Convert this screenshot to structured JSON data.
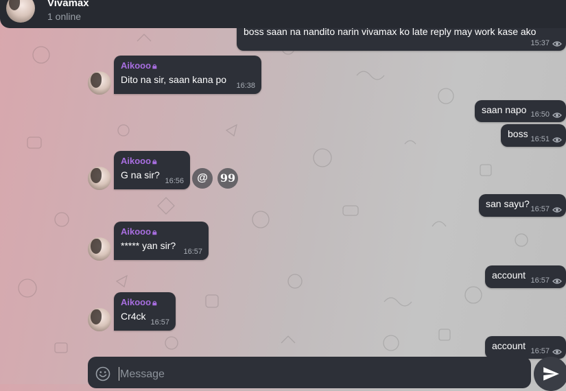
{
  "header": {
    "title": "Vivamax",
    "subtitle": "1 online"
  },
  "messages": [
    {
      "dir": "out",
      "text": "boss saan na nandito narin vivamax ko late reply may work kase ako",
      "time": "15:37"
    },
    {
      "dir": "in",
      "sender": "Aikooo",
      "text": "Dito na sir, saan kana po",
      "time": "16:38"
    },
    {
      "dir": "out",
      "text": "saan napo",
      "time": "16:50"
    },
    {
      "dir": "out",
      "text": "boss",
      "time": "16:51"
    },
    {
      "dir": "in",
      "sender": "Aikooo",
      "text": "G na sir?",
      "time": "16:56"
    },
    {
      "dir": "out",
      "text": "san sayu?",
      "time": "16:57"
    },
    {
      "dir": "in",
      "sender": "Aikooo",
      "text": "***** yan sir?",
      "time": "16:57"
    },
    {
      "dir": "out",
      "text": "account",
      "time": "16:57"
    },
    {
      "dir": "in",
      "sender": "Aikooo",
      "text": "Cr4ck",
      "time": "16:57"
    },
    {
      "dir": "out",
      "text": "account",
      "time": "16:57"
    }
  ],
  "actions": {
    "mention_label": "@",
    "quote_label": "99"
  },
  "composer": {
    "placeholder": "Message"
  },
  "colors": {
    "header_bg": "#272a31",
    "bubble_bg": "#2d3038",
    "sender_name": "#a86ee0"
  },
  "icons": {
    "read": "eye-icon",
    "lock": "lock-icon",
    "emoji": "smiley-icon",
    "send": "send-arrow-icon"
  }
}
